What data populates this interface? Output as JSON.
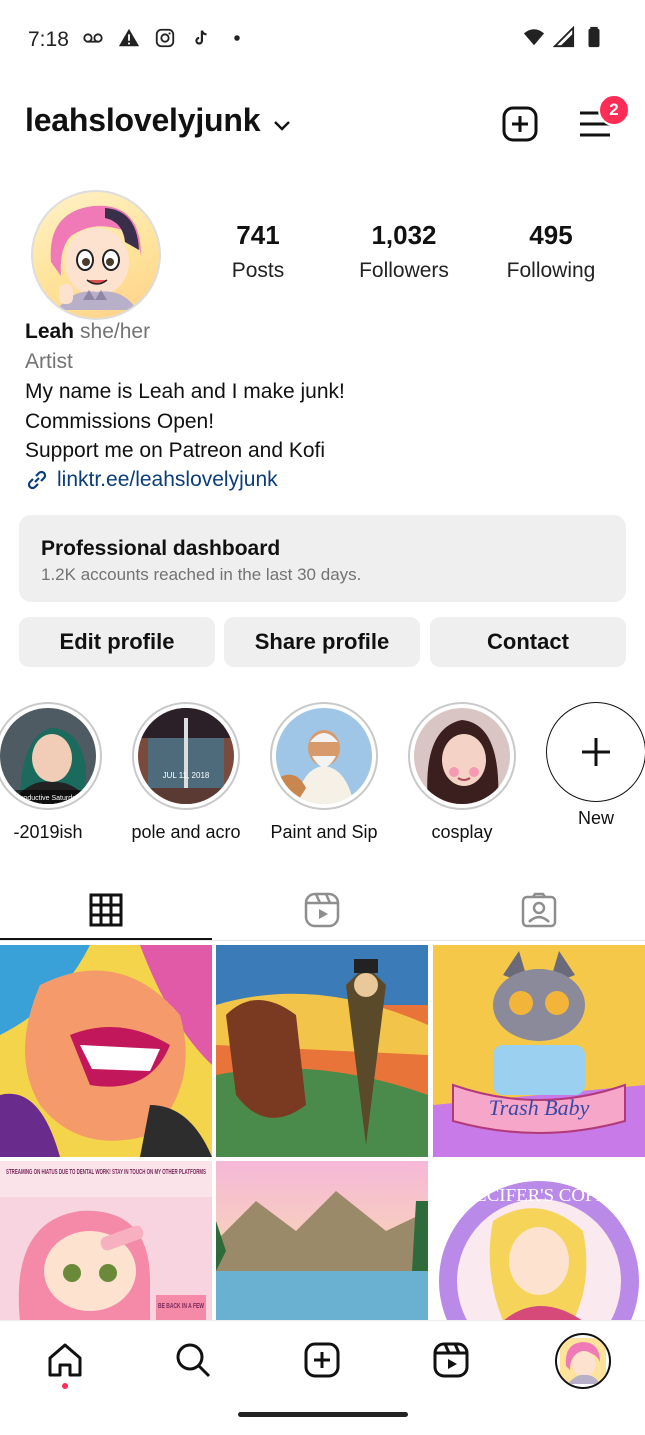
{
  "status_bar": {
    "time": "7:18",
    "icons_left": [
      "voicemail-icon",
      "warning-icon",
      "instagram-icon",
      "tiktok-icon",
      "dot-icon"
    ],
    "icons_right": [
      "wifi-icon",
      "signal-icon",
      "battery-icon"
    ]
  },
  "header": {
    "username": "leahslovelyjunk",
    "notification_count": "2"
  },
  "stats": {
    "posts": {
      "value": "741",
      "label": "Posts"
    },
    "followers": {
      "value": "1,032",
      "label": "Followers"
    },
    "following": {
      "value": "495",
      "label": "Following"
    }
  },
  "bio": {
    "name": "Leah",
    "pronouns": "she/her",
    "category": "Artist",
    "lines": [
      "My name is Leah and I make junk!",
      "Commissions Open!",
      "Support me on Patreon and Kofi"
    ],
    "link": "linktr.ee/leahslovelyjunk"
  },
  "dashboard": {
    "title": "Professional dashboard",
    "subtitle": "1.2K accounts reached in the last 30 days."
  },
  "actions": {
    "edit": "Edit profile",
    "share": "Share profile",
    "contact": "Contact"
  },
  "highlights": [
    {
      "label": "-2019ish"
    },
    {
      "label": "pole and acro"
    },
    {
      "label": "Paint and Sip"
    },
    {
      "label": "cosplay"
    },
    {
      "label": "New"
    }
  ],
  "highlight_overlays": {
    "first": "Productive Saturday",
    "second": "JUL 11, 2018"
  },
  "grid_texts": {
    "post4_banner": "STREAMING ON HIATUS DUE TO DENTAL WORK! STAY IN TOUCH ON MY OTHER PLATFORMS",
    "post4_corner": "BE BACK IN A FEW",
    "post3_ribbon": "Trash Baby",
    "post6_arc": "CALCIFER'S COFFEE"
  },
  "tabs": [
    "grid-tab",
    "reels-tab",
    "tagged-tab"
  ],
  "colors": {
    "badge": "#ff2d55",
    "link": "#0b3d78",
    "button_bg": "#efefef",
    "muted_text": "#737373"
  }
}
